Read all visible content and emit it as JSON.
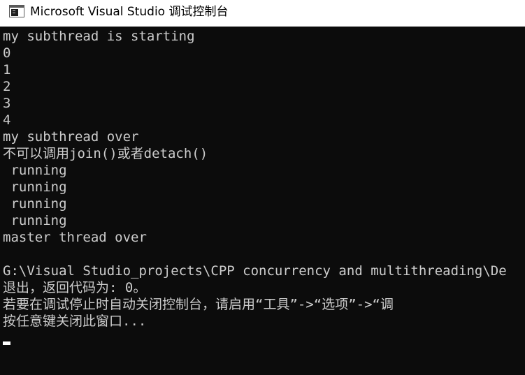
{
  "window": {
    "title": "Microsoft Visual Studio 调试控制台",
    "icon": "console-app-icon"
  },
  "console": {
    "lines": [
      "my subthread is starting",
      "0",
      "1",
      "2",
      "3",
      "4",
      "my subthread over",
      "不可以调用join()或者detach()",
      " running",
      " running",
      " running",
      " running",
      "master thread over",
      "",
      "G:\\Visual Studio_projects\\CPP concurrency and multithreading\\De",
      "退出，返回代码为: 0。",
      "若要在调试停止时自动关闭控制台，请启用“工具”->“选项”->“调",
      "按任意键关闭此窗口..."
    ]
  }
}
